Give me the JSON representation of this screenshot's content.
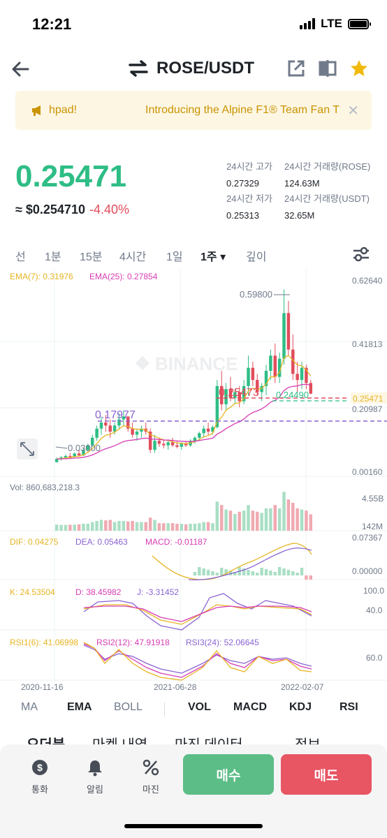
{
  "status": {
    "time": "12:21",
    "network": "LTE"
  },
  "header": {
    "pair": "ROSE/USDT"
  },
  "banner": {
    "text1": "hpad!",
    "text2": "Introducing the Alpine F1® Team Fan T",
    "close": "✕"
  },
  "ticker": {
    "price": "0.25471",
    "fiat": "≈ $0.254710",
    "change": "-4.40%",
    "stats": [
      {
        "label": "24시간 고가",
        "value": "0.27329"
      },
      {
        "label": "24시간 거래량(ROSE)",
        "value": "124.63M"
      },
      {
        "label": "24시간 저가",
        "value": "0.25313"
      },
      {
        "label": "24시간 거래량(USDT)",
        "value": "32.65M"
      }
    ]
  },
  "intervals": [
    "선",
    "1분",
    "15분",
    "4시간",
    "1일",
    "1주 ▾",
    "깊이"
  ],
  "active_interval": "1주",
  "chart_labels": {
    "ema7": "EMA(7): 0.31976",
    "ema25": "EMA(25): 0.27854",
    "watermark": "BINANCE",
    "price_axis": [
      "0.62640",
      "0.41813",
      "0.20987",
      "0.00160"
    ],
    "current_price_tag": "0.25471",
    "high_annot": "0.59800",
    "low_annot": "0.03000",
    "last_annot": "0.25473",
    "level_annot": "0.17977",
    "mid_annot": "0.24490",
    "vol_label": "Vol: 860,683,218.3",
    "vol_axis": [
      "4.55B",
      "142M"
    ],
    "macd_dif": "DIF: 0.04275",
    "macd_dea": "DEA: 0.05463",
    "macd_val": "MACD: -0.01187",
    "macd_axis": [
      "0.07367",
      "0.00000"
    ],
    "kdj_k": "K: 24.53504",
    "kdj_d": "D: 38.45982",
    "kdj_j": "J: -3.31452",
    "kdj_axis": [
      "100.0",
      "40.0"
    ],
    "rsi1": "RSI1(6): 41.06998",
    "rsi2": "RSI2(12): 47.91918",
    "rsi3": "RSI3(24): 52.06645",
    "rsi_axis": [
      "60.0"
    ],
    "dates": [
      "2020-11-16",
      "2021-06-28",
      "2022-02-07"
    ]
  },
  "indicators_left": [
    "MA",
    "EMA",
    "BOLL"
  ],
  "indicators_right": [
    "VOL",
    "MACD",
    "KDJ",
    "RSI"
  ],
  "peek_tabs": [
    "오더북",
    "마켓 내역",
    "마진 데이터",
    "정보"
  ],
  "bottom_nav": [
    {
      "label": "통화",
      "icon": "dollar-coin-icon"
    },
    {
      "label": "알림",
      "icon": "bell-icon"
    },
    {
      "label": "마진",
      "icon": "percent-icon"
    }
  ],
  "buy_label": "매수",
  "sell_label": "매도",
  "colors": {
    "up": "#2ebd85",
    "down": "#e04d5c",
    "accent": "#f0b90b",
    "ema7": "#e6b422",
    "ema25": "#d63cb4"
  },
  "chart_data": {
    "type": "candlestick",
    "ohlc_approx": [
      [
        0.03,
        0.045,
        0.028,
        0.04
      ],
      [
        0.04,
        0.05,
        0.035,
        0.045
      ],
      [
        0.045,
        0.055,
        0.04,
        0.05
      ],
      [
        0.05,
        0.06,
        0.044,
        0.048
      ],
      [
        0.048,
        0.062,
        0.045,
        0.058
      ],
      [
        0.058,
        0.07,
        0.05,
        0.052
      ],
      [
        0.052,
        0.075,
        0.05,
        0.07
      ],
      [
        0.07,
        0.09,
        0.065,
        0.085
      ],
      [
        0.085,
        0.12,
        0.08,
        0.11
      ],
      [
        0.11,
        0.15,
        0.1,
        0.14
      ],
      [
        0.14,
        0.18,
        0.12,
        0.16
      ],
      [
        0.16,
        0.185,
        0.13,
        0.15
      ],
      [
        0.15,
        0.17,
        0.11,
        0.13
      ],
      [
        0.13,
        0.16,
        0.12,
        0.15
      ],
      [
        0.15,
        0.19,
        0.14,
        0.17
      ],
      [
        0.17,
        0.2,
        0.15,
        0.18
      ],
      [
        0.18,
        0.175,
        0.13,
        0.14
      ],
      [
        0.14,
        0.16,
        0.11,
        0.12
      ],
      [
        0.12,
        0.14,
        0.1,
        0.13
      ],
      [
        0.13,
        0.15,
        0.11,
        0.14
      ],
      [
        0.14,
        0.16,
        0.12,
        0.13
      ],
      [
        0.13,
        0.14,
        0.06,
        0.07
      ],
      [
        0.07,
        0.12,
        0.06,
        0.1
      ],
      [
        0.1,
        0.11,
        0.08,
        0.09
      ],
      [
        0.09,
        0.105,
        0.075,
        0.085
      ],
      [
        0.085,
        0.1,
        0.07,
        0.095
      ],
      [
        0.095,
        0.11,
        0.08,
        0.085
      ],
      [
        0.085,
        0.1,
        0.075,
        0.08
      ],
      [
        0.08,
        0.095,
        0.07,
        0.09
      ],
      [
        0.09,
        0.1,
        0.08,
        0.085
      ],
      [
        0.085,
        0.105,
        0.08,
        0.1
      ],
      [
        0.1,
        0.115,
        0.09,
        0.11
      ],
      [
        0.11,
        0.13,
        0.1,
        0.125
      ],
      [
        0.125,
        0.15,
        0.11,
        0.14
      ],
      [
        0.14,
        0.16,
        0.12,
        0.13
      ],
      [
        0.13,
        0.15,
        0.12,
        0.145
      ],
      [
        0.145,
        0.3,
        0.14,
        0.28
      ],
      [
        0.28,
        0.33,
        0.2,
        0.22
      ],
      [
        0.22,
        0.29,
        0.2,
        0.27
      ],
      [
        0.27,
        0.31,
        0.23,
        0.24
      ],
      [
        0.24,
        0.27,
        0.22,
        0.26
      ],
      [
        0.26,
        0.28,
        0.21,
        0.23
      ],
      [
        0.23,
        0.3,
        0.22,
        0.28
      ],
      [
        0.28,
        0.38,
        0.25,
        0.34
      ],
      [
        0.34,
        0.36,
        0.28,
        0.3
      ],
      [
        0.3,
        0.32,
        0.25,
        0.26
      ],
      [
        0.26,
        0.29,
        0.23,
        0.28
      ],
      [
        0.28,
        0.35,
        0.25,
        0.33
      ],
      [
        0.33,
        0.4,
        0.3,
        0.38
      ],
      [
        0.38,
        0.42,
        0.29,
        0.31
      ],
      [
        0.31,
        0.39,
        0.29,
        0.37
      ],
      [
        0.37,
        0.598,
        0.35,
        0.52
      ],
      [
        0.52,
        0.56,
        0.38,
        0.4
      ],
      [
        0.4,
        0.45,
        0.3,
        0.32
      ],
      [
        0.32,
        0.36,
        0.26,
        0.3
      ],
      [
        0.3,
        0.36,
        0.27,
        0.34
      ],
      [
        0.34,
        0.35,
        0.27,
        0.29
      ],
      [
        0.29,
        0.3,
        0.253,
        0.255
      ]
    ],
    "ylim": [
      0.0016,
      0.6264
    ]
  }
}
